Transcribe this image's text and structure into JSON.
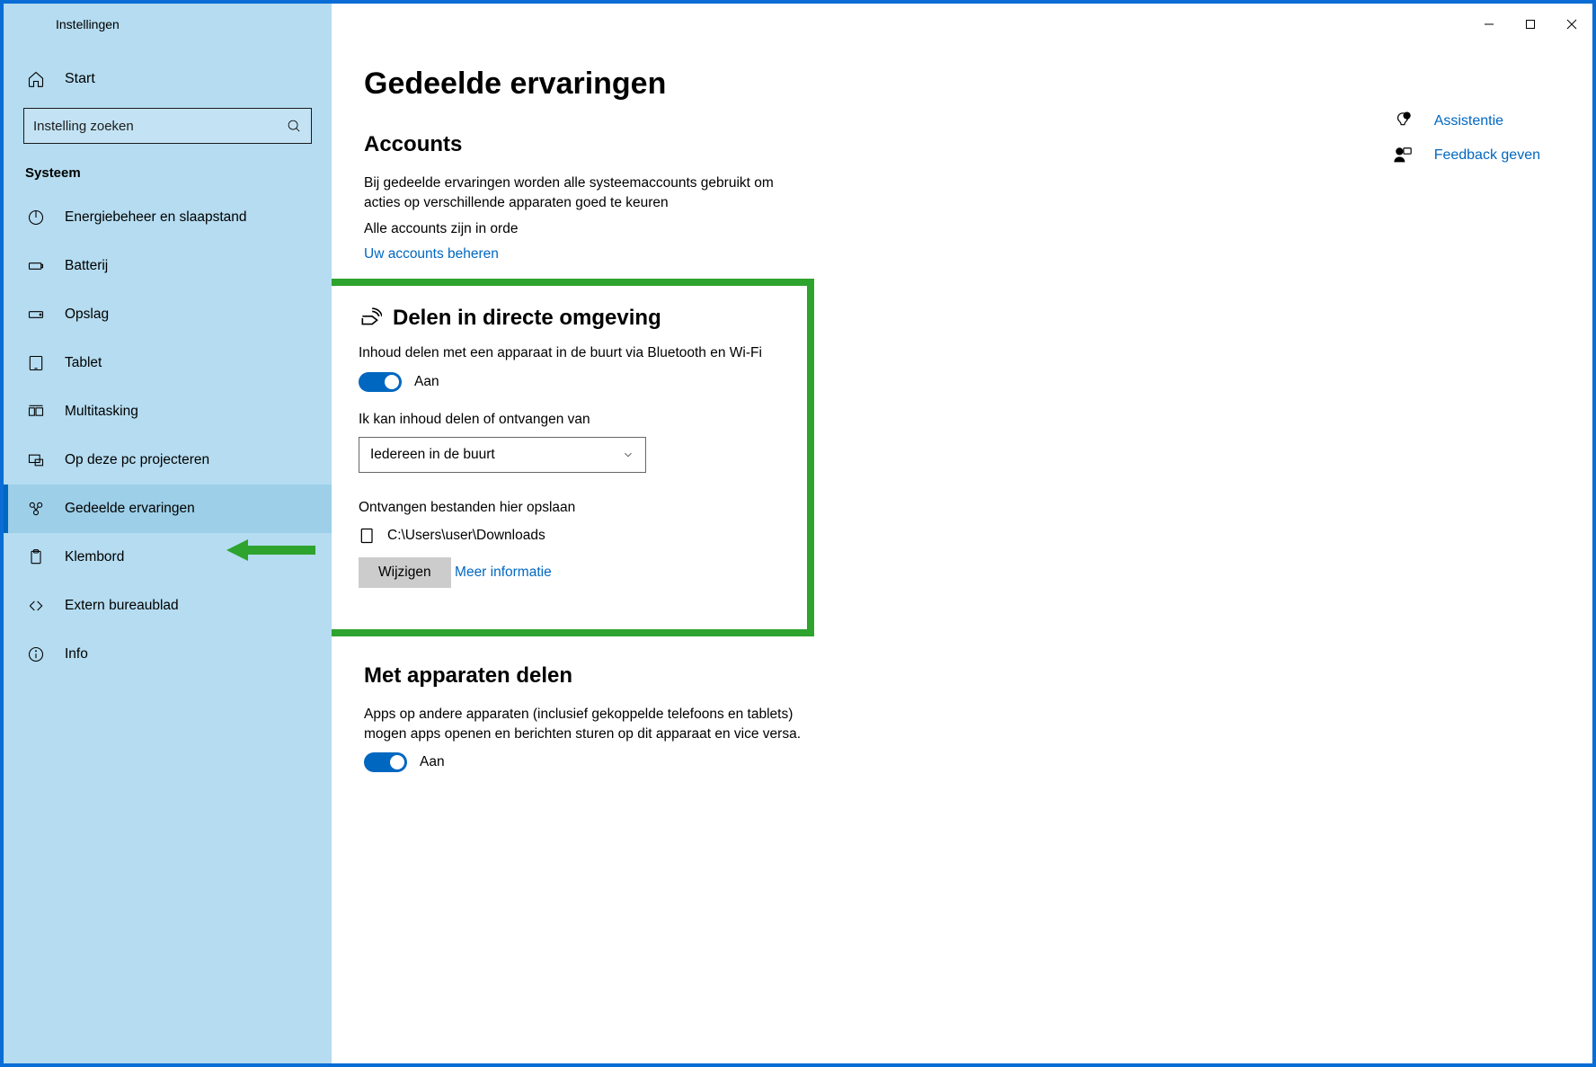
{
  "window": {
    "title": "Instellingen"
  },
  "sidebar": {
    "start": "Start",
    "search_placeholder": "Instelling zoeken",
    "category": "Systeem",
    "items": [
      {
        "label": "Energiebeheer en slaapstand",
        "icon": "power"
      },
      {
        "label": "Batterij",
        "icon": "battery"
      },
      {
        "label": "Opslag",
        "icon": "storage"
      },
      {
        "label": "Tablet",
        "icon": "tablet"
      },
      {
        "label": "Multitasking",
        "icon": "multitask"
      },
      {
        "label": "Op deze pc projecteren",
        "icon": "project"
      },
      {
        "label": "Gedeelde ervaringen",
        "icon": "shared",
        "active": true
      },
      {
        "label": "Klembord",
        "icon": "clipboard"
      },
      {
        "label": "Extern bureaublad",
        "icon": "remote"
      },
      {
        "label": "Info",
        "icon": "info"
      }
    ]
  },
  "page": {
    "title": "Gedeelde ervaringen",
    "accounts": {
      "heading": "Accounts",
      "desc": "Bij gedeelde ervaringen worden alle systeemaccounts gebruikt om acties op verschillende apparaten goed te keuren",
      "status": "Alle accounts zijn in orde",
      "manage_link": "Uw accounts beheren"
    },
    "nearby": {
      "heading": "Delen in directe omgeving",
      "desc": "Inhoud delen met een apparaat in de buurt via Bluetooth en Wi-Fi",
      "toggle_state": "Aan",
      "share_from_label": "Ik kan inhoud delen of ontvangen van",
      "share_from_value": "Iedereen in de buurt",
      "save_label": "Ontvangen bestanden hier opslaan",
      "save_path": "C:\\Users\\user\\Downloads",
      "change_btn": "Wijzigen",
      "more_info": "Meer informatie"
    },
    "devices": {
      "heading": "Met apparaten delen",
      "desc": "Apps op andere apparaten (inclusief gekoppelde telefoons en tablets) mogen apps openen en berichten sturen op dit apparaat en vice versa.",
      "toggle_state": "Aan"
    }
  },
  "right_links": {
    "help": "Assistentie",
    "feedback": "Feedback geven"
  }
}
